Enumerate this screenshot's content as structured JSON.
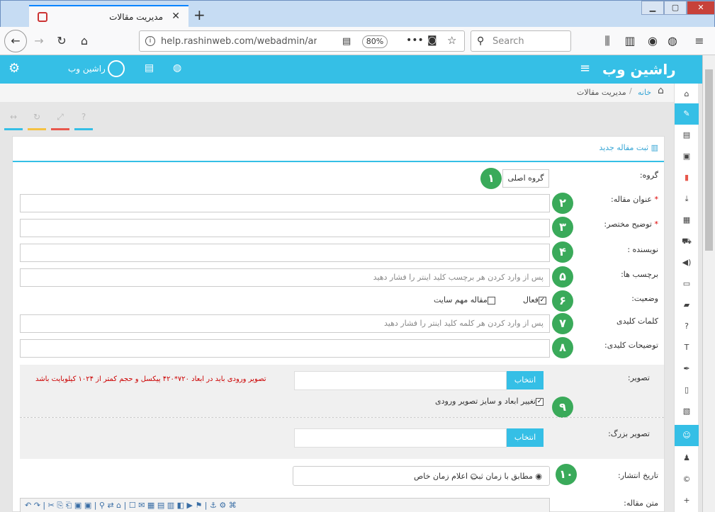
{
  "browser": {
    "tab_title": "مدیریت مقالات",
    "url": "help.rashinweb.com/webadmin/artic",
    "zoom": "80%",
    "search_placeholder": "Search"
  },
  "header": {
    "logo": "راشین وب",
    "username": "راشین وب"
  },
  "breadcrumb": {
    "home": "خانه",
    "current": "مدیریت مقالات"
  },
  "form": {
    "title": "ثبت مقاله جدید",
    "group_label": "گروه:",
    "group_button": "گروه اصلی",
    "title_label": "عنوان مقاله:",
    "summary_label": "توضیح مختصر:",
    "author_label": "نویسنده :",
    "tags_label": "برچسب ها:",
    "tags_placeholder": "پس از وارد کردن هر برچسب کلید اینتر را فشار دهید",
    "status_label": "وضعیت:",
    "active_label": "فعال",
    "important_label": "مقاله مهم سایت",
    "keywords_label": "کلمات کلیدی",
    "keywords_placeholder": "پس از وارد کردن هر کلمه کلید اینتر را فشار دهید",
    "keyword_desc_label": "توضیحات کلیدی:",
    "image_label": "تصویر:",
    "select_button": "انتخاب",
    "image_hint": "تصویر ورودی باید در ابعاد ۷۲۰*۴۲۰ پیکسل و حجم کمتر از ۱۰۲۴ کیلوبایت باشد",
    "resize_label": "تغییر ابعاد و سایز تصویر ورودی",
    "big_image_label": "تصویر بزرگ:",
    "publish_label": "تاریخ انتشار:",
    "publish_opt1": "مطابق با زمان ثبت",
    "publish_opt2": "اعلام زمان خاص",
    "body_label": "متن مقاله:"
  },
  "markers": [
    "١",
    "٢",
    "٣",
    "۴",
    "۵",
    "۶",
    "٧",
    "٨",
    "٩",
    "١٠"
  ],
  "colors": {
    "accent": "#35bfe6",
    "marker": "#3aaa5a",
    "hint": "#cc0000"
  }
}
